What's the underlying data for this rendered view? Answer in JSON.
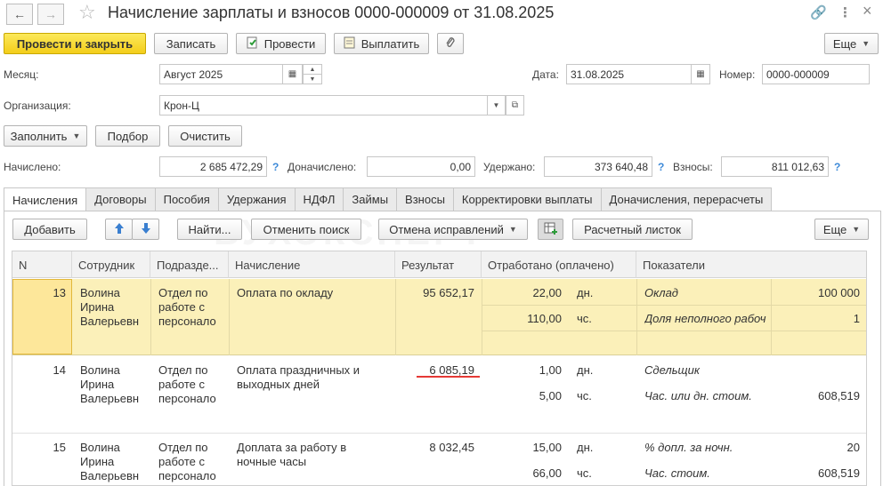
{
  "window": {
    "title": "Начисление зарплаты и взносов 0000-000009 от 31.08.2025",
    "back": "←",
    "forward": "→",
    "star": "☆",
    "link": "🔗",
    "more": "⋮",
    "close": "×"
  },
  "toolbar": {
    "post_close": "Провести и закрыть",
    "save": "Записать",
    "post": "Провести",
    "pay": "Выплатить",
    "more": "Еще"
  },
  "header": {
    "month_label": "Месяц:",
    "month_value": "Август 2025",
    "date_label": "Дата:",
    "date_value": "31.08.2025",
    "number_label": "Номер:",
    "number_value": "0000-000009",
    "org_label": "Организация:",
    "org_value": "Крон-Ц"
  },
  "actions": {
    "fill": "Заполнить",
    "select": "Подбор",
    "clear": "Очистить"
  },
  "totals": {
    "accrued_label": "Начислено:",
    "accrued_value": "2 685 472,29",
    "extra_label": "Доначислено:",
    "extra_value": "0,00",
    "withheld_label": "Удержано:",
    "withheld_value": "373 640,48",
    "contrib_label": "Взносы:",
    "contrib_value": "811 012,63",
    "help": "?"
  },
  "tabs": [
    "Начисления",
    "Договоры",
    "Пособия",
    "Удержания",
    "НДФЛ",
    "Займы",
    "Взносы",
    "Корректировки выплаты",
    "Доначисления, перерасчеты"
  ],
  "grid_toolbar": {
    "add": "Добавить",
    "find": "Найти...",
    "cancel_search": "Отменить поиск",
    "cancel_fix": "Отмена исправлений",
    "payslip": "Расчетный листок",
    "more": "Еще"
  },
  "watermark": "БУХЭКСПЕРТ",
  "columns": [
    "N",
    "Сотрудник",
    "Подразде...",
    "Начисление",
    "Результат",
    "Отработано (оплачено)",
    "Показатели"
  ],
  "rows": [
    {
      "n": "13",
      "employee": [
        "Волина",
        "Ирина",
        "Валерьевн"
      ],
      "dept": [
        "Отдел по",
        "работе с",
        "персонало"
      ],
      "accrual": [
        "Оплата по окладу"
      ],
      "result": "95 652,17",
      "worked": [
        {
          "v": "22,00",
          "u": "дн."
        },
        {
          "v": "110,00",
          "u": "чс."
        }
      ],
      "indicators": [
        {
          "name": "Оклад",
          "value": "100 000"
        },
        {
          "name": "Доля неполного рабоч",
          "value": "1"
        }
      ]
    },
    {
      "n": "14",
      "employee": [
        "Волина",
        "Ирина",
        "Валерьевн"
      ],
      "dept": [
        "Отдел по",
        "работе с",
        "персонало"
      ],
      "accrual": [
        "Оплата праздничных и",
        "выходных дней"
      ],
      "result": "6 085,19",
      "worked": [
        {
          "v": "1,00",
          "u": "дн."
        },
        {
          "v": "5,00",
          "u": "чс."
        }
      ],
      "indicators": [
        {
          "name": "Сдельщик",
          "value": ""
        },
        {
          "name": "Час. или дн. стоим.",
          "value": "608,519"
        }
      ]
    },
    {
      "n": "15",
      "employee": [
        "Волина",
        "Ирина",
        "Валерьевн"
      ],
      "dept": [
        "Отдел по",
        "работе с",
        "персонало"
      ],
      "accrual": [
        "Доплата за работу в",
        "ночные часы"
      ],
      "result": "8 032,45",
      "worked": [
        {
          "v": "15,00",
          "u": "дн."
        },
        {
          "v": "66,00",
          "u": "чс."
        }
      ],
      "indicators": [
        {
          "name": "% допл. за ночн.",
          "value": "20"
        },
        {
          "name": "Час. стоим.",
          "value": "608,519"
        }
      ]
    }
  ]
}
